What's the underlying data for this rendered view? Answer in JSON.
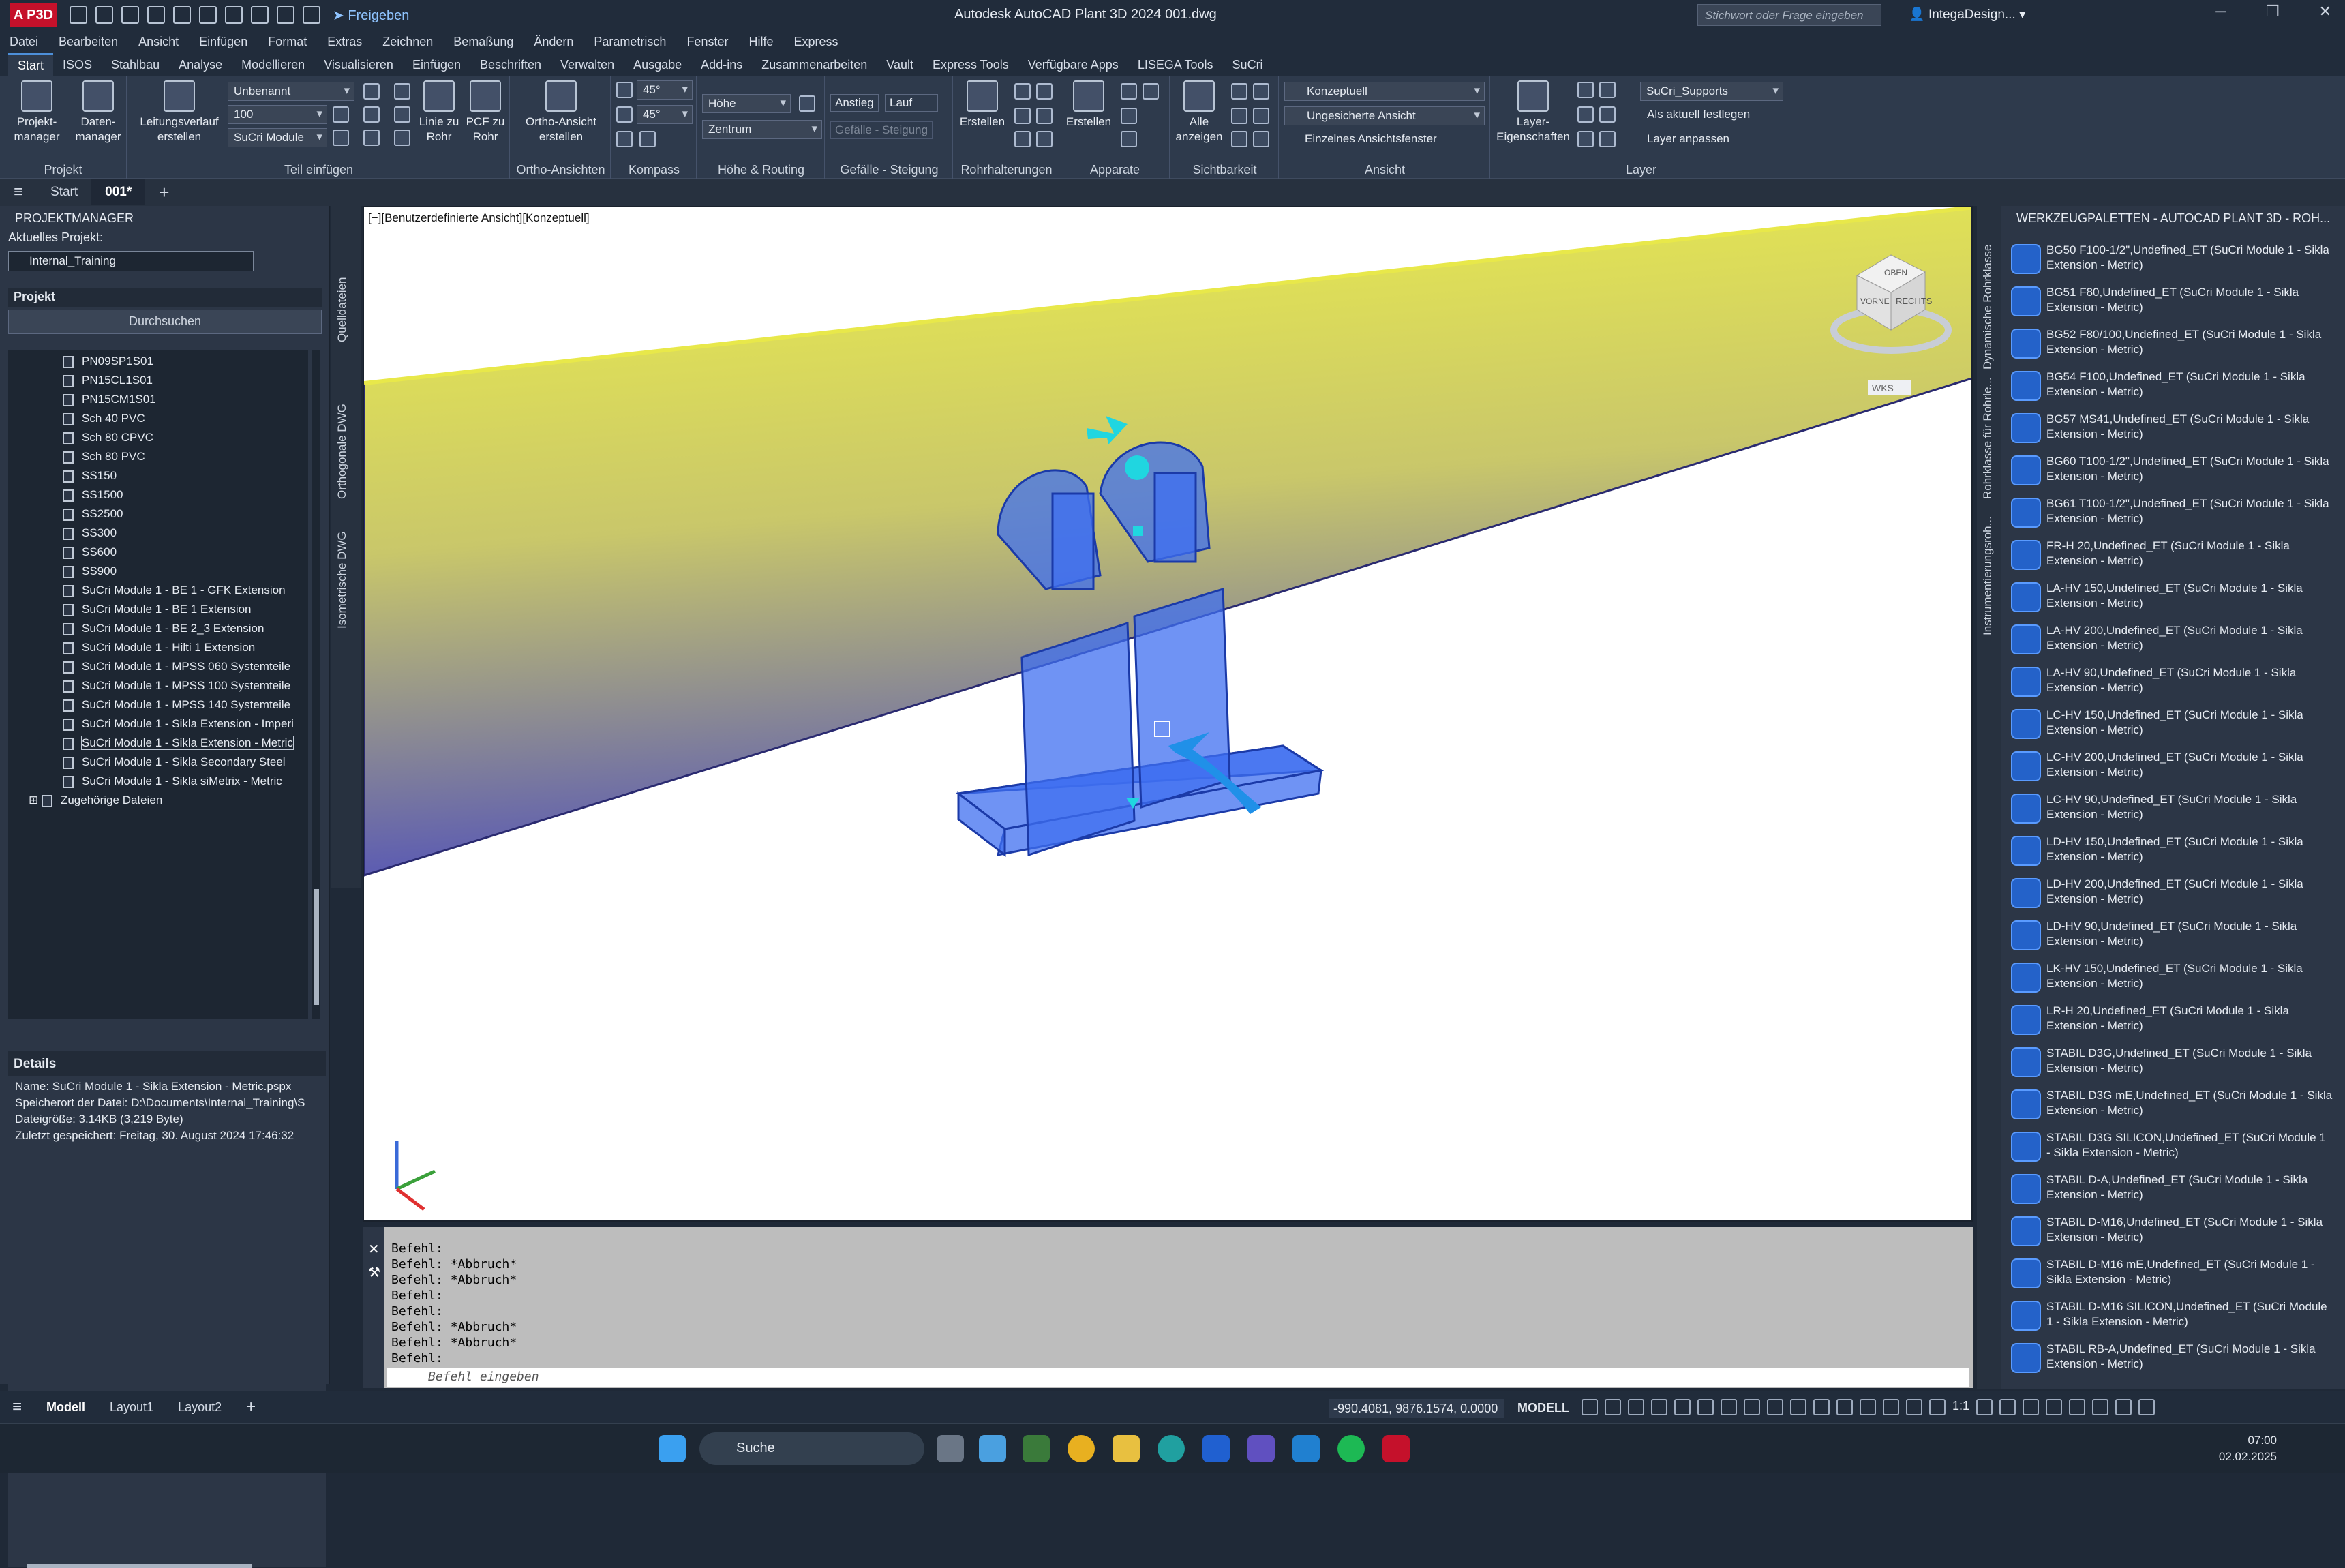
{
  "title": "Autodesk AutoCAD Plant 3D 2024    001.dwg",
  "app_badge": "A P3D",
  "share": "Freigeben",
  "search_placeholder": "Stichwort oder Frage eingeben",
  "user": "IntegaDesign...",
  "menu": [
    "Datei",
    "Bearbeiten",
    "Ansicht",
    "Einfügen",
    "Format",
    "Extras",
    "Zeichnen",
    "Bemaßung",
    "Ändern",
    "Parametrisch",
    "Fenster",
    "Hilfe",
    "Express"
  ],
  "ribbon_tabs": [
    "Start",
    "ISOS",
    "Stahlbau",
    "Analyse",
    "Modellieren",
    "Visualisieren",
    "Einfügen",
    "Beschriften",
    "Verwalten",
    "Ausgabe",
    "Add-ins",
    "Zusammenarbeiten",
    "Vault",
    "Express Tools",
    "Verfügbare Apps",
    "LISEGA Tools",
    "SuCri"
  ],
  "ribbon": {
    "projekt": {
      "title": "Projekt",
      "b1": "Projekt-\nmanager",
      "b2": "Daten-\nmanager"
    },
    "teil": {
      "title": "Teil einfügen",
      "b1": "Leitungsverlauf\nerstellen",
      "c1": "Unbenannt",
      "c2": "100",
      "c3": "SuCri Module",
      "b2": "Linie zu\nRohr",
      "b3": "PCF zu\nRohr",
      "pcf": "PCF"
    },
    "ortho": {
      "title": "Ortho-Ansichten",
      "b1": "Ortho-Ansicht\nerstellen"
    },
    "kompass": {
      "title": "Kompass",
      "a1": "45°",
      "a2": "45°"
    },
    "hoehe": {
      "title": "Höhe & Routing",
      "c1": "Höhe",
      "c2": "Zentrum"
    },
    "gefaelle": {
      "title": "Gefälle - Steigung",
      "a": "Anstieg",
      "b": "Lauf",
      "c": "Gefälle - Steigung"
    },
    "rohr": {
      "title": "Rohrhalterungen",
      "b1": "Erstellen"
    },
    "app": {
      "title": "Apparate",
      "b1": "Erstellen"
    },
    "sicht": {
      "title": "Sichtbarkeit",
      "b1": "Alle\nanzeigen"
    },
    "ansicht": {
      "title": "Ansicht",
      "c1": "Konzeptuell",
      "c2": "Ungesicherte Ansicht",
      "c3": "Einzelnes Ansichtsfenster"
    },
    "layer": {
      "title": "Layer",
      "b1": "Layer-\nEigenschaften",
      "c1": "SuCri_Supports",
      "l1": "Als aktuell festlegen",
      "l2": "Layer anpassen"
    }
  },
  "doc_tabs": [
    "Start",
    "001*"
  ],
  "pm": {
    "title": "PROJEKTMANAGER",
    "current_label": "Aktuelles Projekt:",
    "current": "Internal_Training",
    "projekt": "Projekt",
    "search": "Durchsuchen",
    "items": [
      "PN09SP1S01",
      "PN15CL1S01",
      "PN15CM1S01",
      "Sch 40 PVC",
      "Sch 80 CPVC",
      "Sch 80 PVC",
      "SS150",
      "SS1500",
      "SS2500",
      "SS300",
      "SS600",
      "SS900",
      "SuCri Module 1 - BE 1 - GFK Extension",
      "SuCri Module 1 - BE 1 Extension",
      "SuCri Module 1 - BE 2_3 Extension",
      "SuCri Module 1 - Hilti 1 Extension",
      "SuCri Module 1 - MPSS 060 Systemteile",
      "SuCri Module 1 - MPSS 100 Systemteile",
      "SuCri Module 1 - MPSS 140 Systemteile",
      "SuCri Module 1 - Sikla Extension - Imperi",
      "SuCri Module 1 - Sikla Extension - Metric",
      "SuCri Module 1 - Sikla Secondary Steel",
      "SuCri Module 1 - Sikla siMetrix - Metric"
    ],
    "related": "Zugehörige Dateien",
    "details_title": "Details",
    "details": [
      "Name: SuCri Module 1 - Sikla Extension - Metric.pspx",
      "Speicherort der Datei: D:\\Documents\\Internal_Training\\S",
      "Dateigröße: 3.14KB (3,219 Byte)",
      "Zuletzt gespeichert: Freitag, 30. August 2024 17:46:32"
    ]
  },
  "side_tabs": [
    "Quelldateien",
    "Orthogonale DWG",
    "Isometrische DWG"
  ],
  "viewport_label": "[−][Benutzerdefinierte Ansicht][Konzeptuell]",
  "viewcube": {
    "top": "OBEN",
    "front": "VORNE",
    "right": "RECHTS",
    "wcs": "WKS"
  },
  "command_lines": [
    "Befehl:",
    "Befehl: *Abbruch*",
    "Befehl: *Abbruch*",
    "Befehl:",
    "Befehl:",
    "Befehl: *Abbruch*",
    "Befehl: *Abbruch*",
    "Befehl:"
  ],
  "command_placeholder": "Befehl eingeben",
  "palette": {
    "title": "WERKZEUGPALETTEN - AUTOCAD PLANT 3D - ROH...",
    "strip_tabs": [
      "Dynamische Rohrklasse",
      "Rohrklasse für Rohrle...",
      "Instrumentierungsroh..."
    ],
    "items": [
      "BG50 F100-1/2\",Undefined_ET (SuCri Module 1 - Sikla Extension - Metric)",
      "BG51 F80,Undefined_ET (SuCri Module 1 - Sikla Extension - Metric)",
      "BG52 F80/100,Undefined_ET (SuCri Module 1 - Sikla Extension - Metric)",
      "BG54 F100,Undefined_ET (SuCri Module 1 - Sikla Extension - Metric)",
      "BG57 MS41,Undefined_ET (SuCri Module 1 - Sikla Extension - Metric)",
      "BG60 T100-1/2\",Undefined_ET (SuCri Module 1 - Sikla Extension - Metric)",
      "BG61 T100-1/2\",Undefined_ET (SuCri Module 1 - Sikla Extension - Metric)",
      "FR-H 20,Undefined_ET (SuCri Module 1 - Sikla Extension - Metric)",
      "LA-HV 150,Undefined_ET (SuCri Module 1 - Sikla Extension - Metric)",
      "LA-HV 200,Undefined_ET (SuCri Module 1 - Sikla Extension - Metric)",
      "LA-HV 90,Undefined_ET (SuCri Module 1 - Sikla Extension - Metric)",
      "LC-HV 150,Undefined_ET (SuCri Module 1 - Sikla Extension - Metric)",
      "LC-HV 200,Undefined_ET (SuCri Module 1 - Sikla Extension - Metric)",
      "LC-HV 90,Undefined_ET (SuCri Module 1 - Sikla Extension - Metric)",
      "LD-HV 150,Undefined_ET (SuCri Module 1 - Sikla Extension - Metric)",
      "LD-HV 200,Undefined_ET (SuCri Module 1 - Sikla Extension - Metric)",
      "LD-HV 90,Undefined_ET (SuCri Module 1 - Sikla Extension - Metric)",
      "LK-HV 150,Undefined_ET (SuCri Module 1 - Sikla Extension - Metric)",
      "LR-H 20,Undefined_ET (SuCri Module 1 - Sikla Extension - Metric)",
      "STABIL D3G,Undefined_ET (SuCri Module 1 - Sikla Extension - Metric)",
      "STABIL D3G mE,Undefined_ET (SuCri Module 1 - Sikla Extension - Metric)",
      "STABIL D3G SILICON,Undefined_ET (SuCri Module 1 - Sikla Extension - Metric)",
      "STABIL D-A,Undefined_ET (SuCri Module 1 - Sikla Extension - Metric)",
      "STABIL D-M16,Undefined_ET (SuCri Module 1 - Sikla Extension - Metric)",
      "STABIL D-M16 mE,Undefined_ET (SuCri Module 1 - Sikla Extension - Metric)",
      "STABIL D-M16 SILICON,Undefined_ET (SuCri Module 1 - Sikla Extension - Metric)",
      "STABIL RB-A,Undefined_ET (SuCri Module 1 - Sikla Extension - Metric)"
    ]
  },
  "status": {
    "tabs": [
      "Modell",
      "Layout1",
      "Layout2"
    ],
    "coords": "-990.4081, 9876.1574, 0.0000",
    "mode": "MODELL",
    "scale": "1:1"
  },
  "taskbar": {
    "search": "Suche",
    "time": "07:00",
    "date": "02.02.2025"
  },
  "colors": {
    "pipe": "#e8e84a",
    "support": "#2f63e0",
    "accent": "#20d6e0"
  }
}
